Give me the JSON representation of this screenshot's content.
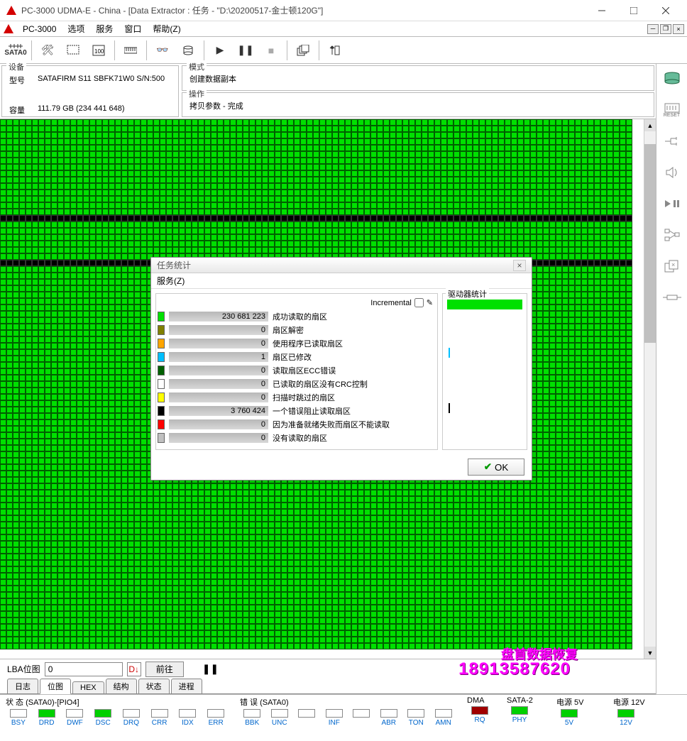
{
  "window": {
    "title": "PC-3000 UDMA-E - China - [Data Extractor : 任务 - \"D:\\20200517-金士顿120G\"]",
    "app": "PC-3000"
  },
  "menu": {
    "items": [
      "选项",
      "服务",
      "窗口",
      "帮助(Z)"
    ]
  },
  "toolbar": {
    "sata0": "SATA0"
  },
  "device": {
    "header": "设备",
    "model_lbl": "型号",
    "model": "SATAFIRM   S11 SBFK71W0 S/N:500",
    "capacity_lbl": "容量",
    "capacity": "111.79 GB (234 441 648)"
  },
  "mode": {
    "header": "模式",
    "value": "创建数据副本"
  },
  "operation": {
    "header": "操作",
    "value": "拷贝参数 - 完成"
  },
  "lba": {
    "label": "LBA位图",
    "value": "0",
    "go": "前往"
  },
  "tabs": [
    "日志",
    "位图",
    "HEX",
    "结构",
    "状态",
    "进程"
  ],
  "status": {
    "g1": "状 态 (SATA0)-[PIO4]",
    "g2": "错 误 (SATA0)",
    "g3": "DMA",
    "g4": "SATA-2",
    "g5": "电源 5V",
    "g6": "电源 12V",
    "leds1": [
      "BSY",
      "DRD",
      "DWF",
      "DSC",
      "DRQ",
      "CRR",
      "IDX",
      "ERR"
    ],
    "leds2": [
      "BBK",
      "UNC",
      "",
      "INF",
      "",
      "ABR",
      "TON",
      "AMN"
    ],
    "leds3": [
      "RQ"
    ],
    "leds4": [
      "PHY"
    ],
    "leds5": [
      "5V"
    ],
    "leds6": [
      "12V"
    ]
  },
  "dialog": {
    "title": "任务统计",
    "menu": "服务(Z)",
    "incremental": "Incremental",
    "right_header": "驱动器统计",
    "ok": "OK",
    "stats": [
      {
        "color": "#00e000",
        "value": "230 681 223",
        "label": "成功读取的扇区"
      },
      {
        "color": "#808000",
        "value": "0",
        "label": "扇区解密"
      },
      {
        "color": "#ffa500",
        "value": "0",
        "label": "使用程序已读取扇区"
      },
      {
        "color": "#00bfff",
        "value": "1",
        "label": "扇区已修改"
      },
      {
        "color": "#006000",
        "value": "0",
        "label": "读取扇区ECC错误"
      },
      {
        "color": "#ffffff",
        "value": "0",
        "label": "已读取的扇区没有CRC控制"
      },
      {
        "color": "#ffff00",
        "value": "0",
        "label": "扫描时跳过的扇区"
      },
      {
        "color": "#000000",
        "value": "3 760 424",
        "label": "一个错误阻止读取扇区"
      },
      {
        "color": "#ff0000",
        "value": "0",
        "label": "因为准备就绪失败而扇区不能读取"
      },
      {
        "color": "#c0c0c0",
        "value": "0",
        "label": "没有读取的扇区"
      }
    ]
  },
  "watermark": {
    "line1": "盘首数据恢复",
    "line2": "18913587620"
  }
}
